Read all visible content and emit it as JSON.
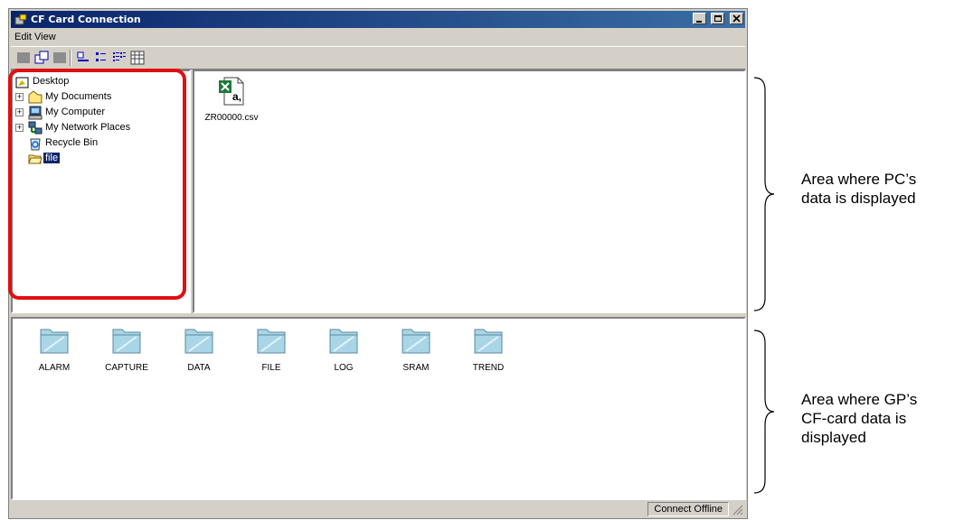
{
  "window": {
    "title": "CF Card Connection",
    "controls": [
      "minimize",
      "maximize",
      "close"
    ]
  },
  "menu": {
    "items": [
      {
        "label": "Edit",
        "mnemonic": "E"
      },
      {
        "label": "View",
        "mnemonic": "V"
      }
    ]
  },
  "toolbar": {
    "buttons": [
      "up-folder",
      "copy",
      "paste",
      "large-icons",
      "small-icons",
      "list",
      "details"
    ]
  },
  "tree": {
    "items": [
      {
        "label": "Desktop",
        "icon": "desktop-icon",
        "expander": ""
      },
      {
        "label": "My Documents",
        "icon": "documents-folder-icon",
        "expander": "+"
      },
      {
        "label": "My Computer",
        "icon": "computer-icon",
        "expander": "+"
      },
      {
        "label": "My Network Places",
        "icon": "network-icon",
        "expander": "+"
      },
      {
        "label": "Recycle Bin",
        "icon": "recycle-bin-icon",
        "expander": ""
      },
      {
        "label": "file",
        "icon": "open-folder-icon",
        "expander": "",
        "selected": true
      }
    ]
  },
  "pc_files": {
    "items": [
      {
        "label": "ZR00000.csv",
        "icon": "csv-file-icon"
      }
    ]
  },
  "cf_folders": {
    "items": [
      "ALARM",
      "CAPTURE",
      "DATA",
      "FILE",
      "LOG",
      "SRAM",
      "TREND"
    ]
  },
  "statusbar": {
    "status": "Connect Offline"
  },
  "annotations": {
    "pc_area": [
      "Area where PC’s",
      "data is displayed"
    ],
    "gp_area": [
      "Area where GP’s",
      "CF-card data is",
      "displayed"
    ]
  },
  "colors": {
    "titlebar": "#0a246a",
    "highlight": "#e01010",
    "window_face": "#d4d0c8",
    "folder": "#a9d6e6"
  }
}
